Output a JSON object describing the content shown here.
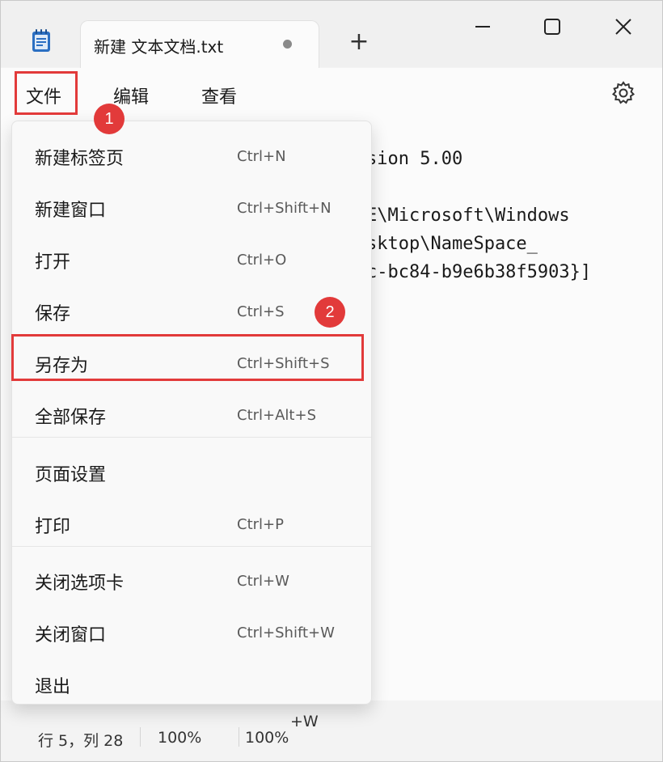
{
  "window": {
    "tab_title": "新建 文本文档.txt",
    "new_tab_label": "+"
  },
  "menubar": {
    "file": "文件",
    "edit": "编辑",
    "view": "查看"
  },
  "editor": {
    "lines": [
      "sion 5.00",
      "E\\Microsoft\\Windows",
      "sktop\\NameSpace_",
      "c-bc84-b9e6b38f5903}]"
    ]
  },
  "file_menu": {
    "items": [
      {
        "label": "新建标签页",
        "shortcut": "Ctrl+N"
      },
      {
        "label": "新建窗口",
        "shortcut": "Ctrl+Shift+N"
      },
      {
        "label": "打开",
        "shortcut": "Ctrl+O"
      },
      {
        "label": "保存",
        "shortcut": "Ctrl+S"
      },
      {
        "label": "另存为",
        "shortcut": "Ctrl+Shift+S"
      },
      {
        "label": "全部保存",
        "shortcut": "Ctrl+Alt+S"
      },
      {
        "label": "页面设置",
        "shortcut": ""
      },
      {
        "label": "打印",
        "shortcut": "Ctrl+P"
      },
      {
        "label": "关闭选项卡",
        "shortcut": "Ctrl+W"
      },
      {
        "label": "关闭窗口",
        "shortcut": "Ctrl+Shift+W"
      },
      {
        "label": "退出",
        "shortcut": ""
      }
    ]
  },
  "statusbar": {
    "position": "行 5，列 28",
    "zoom": "100%",
    "zoom2": "100%",
    "partial_shortcut": "+W"
  },
  "annotations": {
    "step1": "1",
    "step2": "2",
    "color": "#e23a3a"
  },
  "icons": {
    "app": "notepad-icon",
    "settings": "gear-icon",
    "minimize": "minimize-icon",
    "maximize": "maximize-icon",
    "close": "close-icon"
  }
}
